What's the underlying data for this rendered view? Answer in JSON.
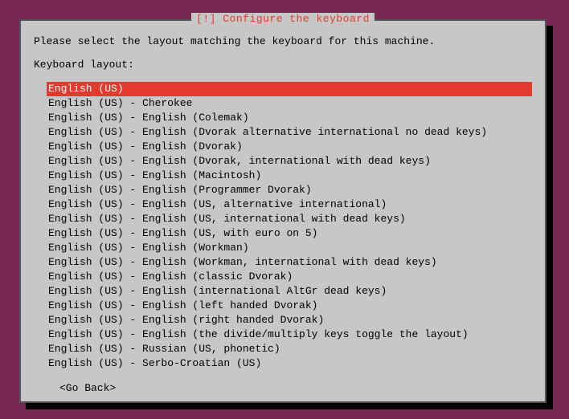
{
  "dialog": {
    "title": "[!] Configure the keyboard",
    "prompt": "Please select the layout matching the keyboard for this machine.",
    "label": "Keyboard layout:",
    "go_back": "<Go Back>",
    "selected_index": 0,
    "layouts": [
      "English (US)",
      "English (US) - Cherokee",
      "English (US) - English (Colemak)",
      "English (US) - English (Dvorak alternative international no dead keys)",
      "English (US) - English (Dvorak)",
      "English (US) - English (Dvorak, international with dead keys)",
      "English (US) - English (Macintosh)",
      "English (US) - English (Programmer Dvorak)",
      "English (US) - English (US, alternative international)",
      "English (US) - English (US, international with dead keys)",
      "English (US) - English (US, with euro on 5)",
      "English (US) - English (Workman)",
      "English (US) - English (Workman, international with dead keys)",
      "English (US) - English (classic Dvorak)",
      "English (US) - English (international AltGr dead keys)",
      "English (US) - English (left handed Dvorak)",
      "English (US) - English (right handed Dvorak)",
      "English (US) - English (the divide/multiply keys toggle the layout)",
      "English (US) - Russian (US, phonetic)",
      "English (US) - Serbo-Croatian (US)"
    ]
  }
}
